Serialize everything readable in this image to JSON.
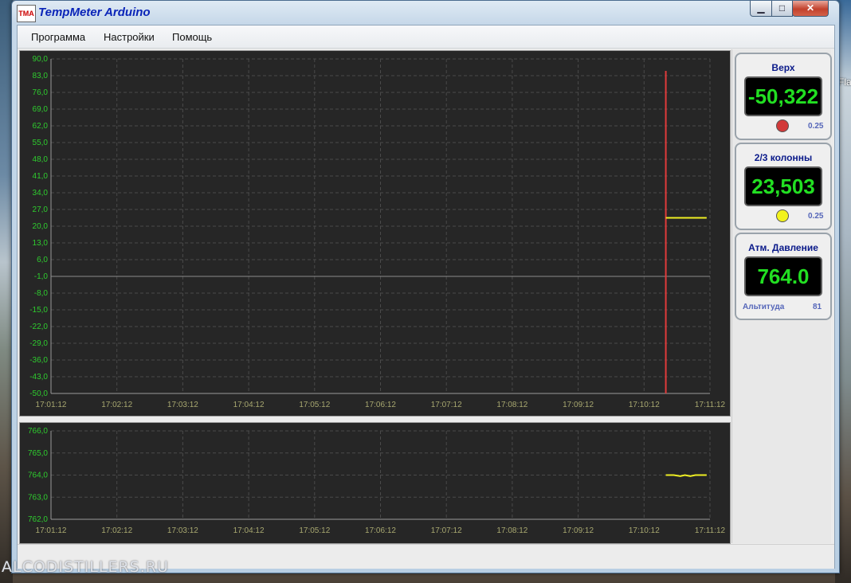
{
  "window": {
    "title": "TempMeter Arduino",
    "icon_text": "TMA",
    "minimize_label": "▁",
    "maximize_label": "□",
    "close_label": "✕"
  },
  "desktop": {
    "label": "Fla",
    "watermark": "ALCODISTILLERS.RU"
  },
  "menu": {
    "items": [
      "Программа",
      "Настройки",
      "Помощь"
    ]
  },
  "gauges": [
    {
      "title": "Верх",
      "value": "-50,322",
      "indicator_color": "#d23a3a",
      "step": "0.25"
    },
    {
      "title": "2/3 колонны",
      "value": "23,503",
      "indicator_color": "#f2f21c",
      "step": "0.25"
    },
    {
      "title": "Атм. Давление",
      "value": "764.0",
      "footer_label": "Альтитуда",
      "footer_value": "81"
    }
  ],
  "colors": {
    "chart_bg": "#262626",
    "grid": "#4a4a4a",
    "y_tick": "#2ecc2e",
    "x_tick": "#a8a870",
    "red_series": "#e03a3a",
    "yellow_series": "#eeee22"
  },
  "chart_data": [
    {
      "type": "line",
      "y_ticks": [
        "90,0",
        "83,0",
        "76,0",
        "69,0",
        "62,0",
        "55,0",
        "48,0",
        "41,0",
        "34,0",
        "27,0",
        "20,0",
        "13,0",
        "6,0",
        "-1,0",
        "-8,0",
        "-15,0",
        "-22,0",
        "-29,0",
        "-36,0",
        "-43,0",
        "-50,0"
      ],
      "x_ticks": [
        "17:01:12",
        "17:02:12",
        "17:03:12",
        "17:04:12",
        "17:05:12",
        "17:06:12",
        "17:07:12",
        "17:08:12",
        "17:09:12",
        "17:10:12",
        "17:11:12"
      ],
      "ylim": [
        -50,
        90
      ],
      "xlim_minutes": [
        0,
        10
      ],
      "reference_line": -1,
      "series": [
        {
          "color": "red",
          "x": [
            9.33,
            9.33
          ],
          "y": [
            -50,
            85
          ]
        },
        {
          "color": "yellow",
          "x": [
            9.33,
            9.95
          ],
          "y": [
            23.5,
            23.5
          ]
        }
      ]
    },
    {
      "type": "line",
      "y_ticks": [
        "766,0",
        "765,0",
        "764,0",
        "763,0",
        "762,0"
      ],
      "x_ticks": [
        "17:01:12",
        "17:02:12",
        "17:03:12",
        "17:04:12",
        "17:05:12",
        "17:06:12",
        "17:07:12",
        "17:08:12",
        "17:09:12",
        "17:10:12",
        "17:11:12"
      ],
      "ylim": [
        762,
        766
      ],
      "xlim_minutes": [
        0,
        10
      ],
      "series": [
        {
          "color": "yellow",
          "x": [
            9.33,
            9.45,
            9.55,
            9.62,
            9.7,
            9.78,
            9.86,
            9.95
          ],
          "y": [
            764.0,
            764.0,
            763.95,
            764.0,
            763.95,
            764.0,
            764.0,
            764.0
          ]
        }
      ]
    }
  ]
}
